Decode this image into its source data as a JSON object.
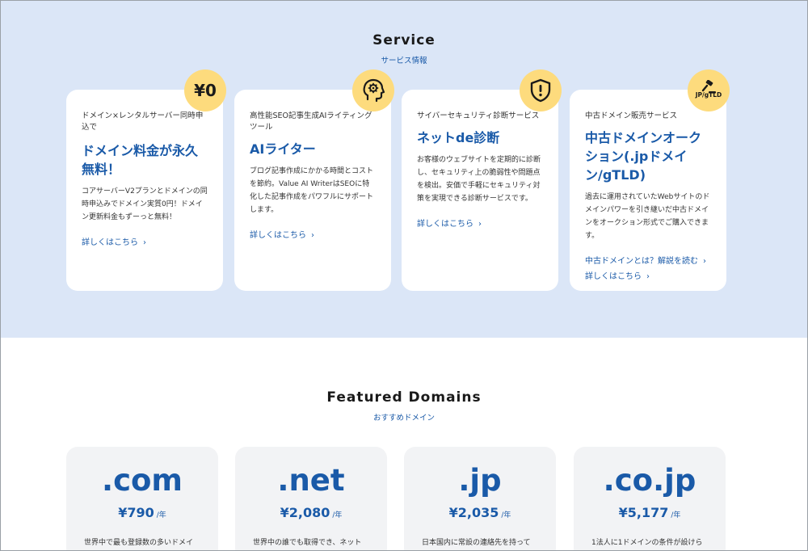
{
  "service": {
    "title": "Service",
    "subtitle": "サービス情報",
    "cards": [
      {
        "badge": "¥0",
        "label": "ドメイン×レンタルサーバー同時申込で",
        "title": "ドメイン料金が永久無料！",
        "desc": "コアサーバーV2プランとドメインの同時申込みでドメイン実質0円！ドメイン更新料金もずーっと無料！",
        "links": [
          "詳しくはこちら"
        ]
      },
      {
        "badge_icon": "ai-head-icon",
        "label": "高性能SEO記事生成AIライティングツール",
        "title": "AIライター",
        "desc": "ブログ記事作成にかかる時間とコストを節約。Value AI WriterはSEOに特化した記事作成をパワフルにサポートします。",
        "links": [
          "詳しくはこちら"
        ]
      },
      {
        "badge_icon": "shield-alert-icon",
        "label": "サイバーセキュリティ診断サービス",
        "title": "ネットde診断",
        "desc": "お客様のウェブサイトを定期的に診断し、セキュリティ上の脆弱性や問題点を検出。安価で手軽にセキュリティ対策を実現できる診断サービスです。",
        "links": [
          "詳しくはこちら"
        ]
      },
      {
        "badge": "JP/gTLD",
        "badge_icon": "gavel-icon",
        "label": "中古ドメイン販売サービス",
        "title": "中古ドメインオークション(.jpドメイン/gTLD)",
        "desc": "過去に運用されていたWebサイトのドメインパワーを引き継いだ中古ドメインをオークション形式でご購入できます。",
        "links": [
          "中古ドメインとは？解説を読む",
          "詳しくはこちら"
        ]
      }
    ]
  },
  "featured": {
    "title": "Featured Domains",
    "subtitle": "おすすめドメイン",
    "unit": "/年",
    "domains": [
      {
        "tld": ".com",
        "price": "¥790",
        "desc": "世界中で最も登録数の多いドメイ"
      },
      {
        "tld": ".net",
        "price": "¥2,080",
        "desc": "世界中の誰でも取得でき、ネット"
      },
      {
        "tld": ".jp",
        "price": "¥2,035",
        "desc": "日本国内に常設の連絡先を持って"
      },
      {
        "tld": ".co.jp",
        "price": "¥5,177",
        "desc": "1法人に1ドメインの条件が設けら"
      }
    ]
  },
  "colors": {
    "accent": "#1a5aa8",
    "badge": "#fddb7d",
    "section_bg": "#dbe6f7"
  }
}
